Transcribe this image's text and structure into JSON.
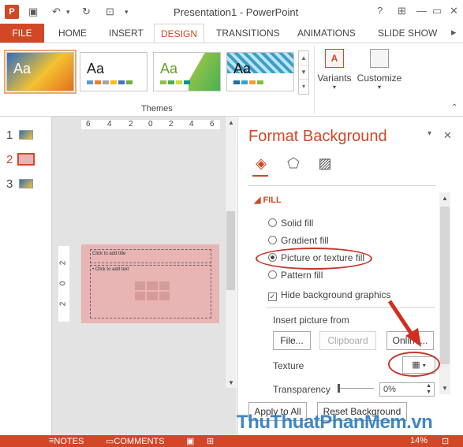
{
  "window": {
    "title": "Presentation1 - PowerPoint",
    "app_icon_letter": "P",
    "help": "?",
    "minimize": "—",
    "restore": "▭",
    "close": "✕"
  },
  "tabs": [
    "FILE",
    "HOME",
    "INSERT",
    "DESIGN",
    "TRANSITIONS",
    "ANIMATIONS",
    "SLIDE SHOW"
  ],
  "ribbon": {
    "theme_sample": "Aa",
    "themes_label": "Themes",
    "variants_label": "Variants",
    "customize_label": "Customize"
  },
  "slides": [
    {
      "number": "1"
    },
    {
      "number": "2"
    },
    {
      "number": "3"
    }
  ],
  "ruler": {
    "h_ticks": [
      "6",
      "4",
      "2",
      "0",
      "2",
      "4",
      "6"
    ],
    "v_ticks": [
      "2",
      "0",
      "2"
    ]
  },
  "slide_placeholders": {
    "title": "Click to add title",
    "text": "• Click to add text"
  },
  "pane": {
    "title": "Format Background",
    "section": "FILL",
    "fill_options": [
      {
        "label": "Solid fill",
        "selected": false
      },
      {
        "label": "Gradient fill",
        "selected": false
      },
      {
        "label": "Picture or texture fill",
        "selected": true
      },
      {
        "label": "Pattern fill",
        "selected": false
      }
    ],
    "hide_background": "Hide background graphics",
    "hide_checked": true,
    "insert_from_label": "Insert picture from",
    "file_button": "File...",
    "clipboard_button": "Clipboard",
    "online_button": "Online...",
    "texture_label": "Texture",
    "transparency_label": "Transparency",
    "transparency_value": "0%",
    "apply_all_button": "Apply to All",
    "reset_button": "Reset Background"
  },
  "status": {
    "notes": "NOTES",
    "comments": "COMMENTS",
    "zoom": "14%"
  },
  "watermark": "ThuThuatPhanMem.vn",
  "colors": {
    "accent": "#d24726",
    "annotation": "#c0392b",
    "slide_fill": "#e8b4b4"
  }
}
